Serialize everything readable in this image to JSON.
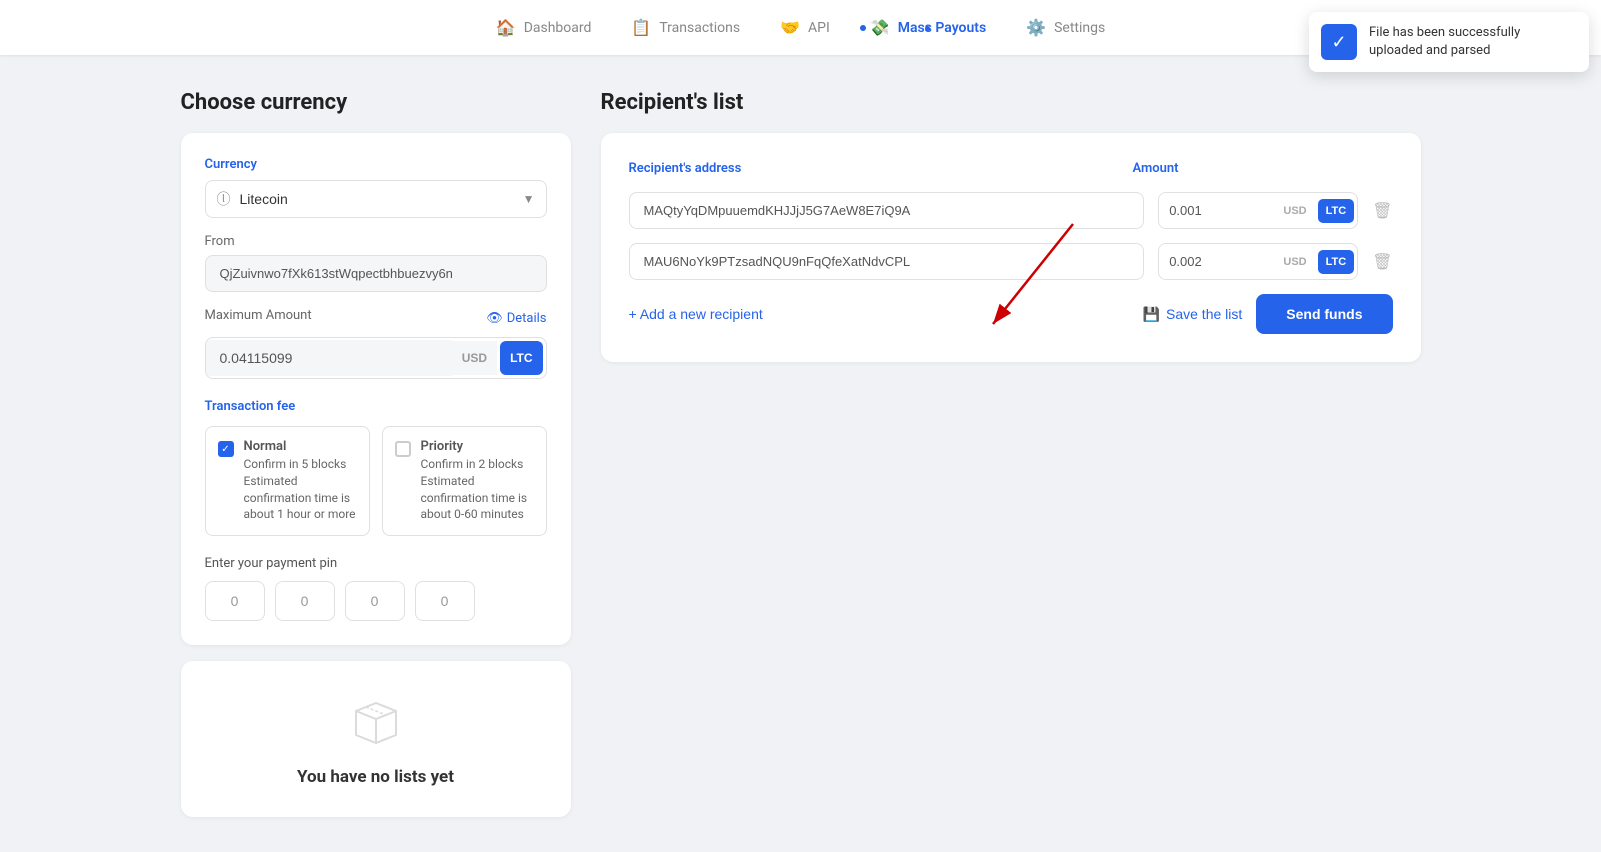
{
  "nav": {
    "items": [
      {
        "id": "dashboard",
        "label": "Dashboard",
        "icon": "🏠",
        "active": false
      },
      {
        "id": "transactions",
        "label": "Transactions",
        "icon": "📋",
        "active": false
      },
      {
        "id": "api",
        "label": "API",
        "icon": "🤝",
        "active": false
      },
      {
        "id": "mass-payouts",
        "label": "Mass Payouts",
        "icon": "💸",
        "active": true
      },
      {
        "id": "settings",
        "label": "Settings",
        "icon": "⚙️",
        "active": false
      }
    ]
  },
  "toast": {
    "message": "File has been successfully uploaded and parsed"
  },
  "left": {
    "section_title": "Choose currency",
    "currency_label": "Currency",
    "currency_value": "Litecoin",
    "from_label": "From",
    "from_value": "QjZuivnwo7fXk613stWqpectbhbuezvy6n",
    "max_amount_label": "Maximum Amount",
    "details_label": "Details",
    "max_amount_value": "0.04115099",
    "usd_btn": "USD",
    "ltc_btn": "LTC",
    "tx_fee_label": "Transaction fee",
    "normal_fee": {
      "name": "Normal",
      "description": "Confirm in 5 blocks Estimated confirmation time is about 1 hour or more"
    },
    "priority_fee": {
      "name": "Priority",
      "description": "Confirm in 2 blocks Estimated confirmation time is about 0-60 minutes"
    },
    "pin_label": "Enter your payment pin",
    "pin_values": [
      "0",
      "0",
      "0",
      "0"
    ]
  },
  "no_lists": {
    "text": "You have no lists yet"
  },
  "right": {
    "section_title": "Recipient's list",
    "addr_col_label": "Recipient's address",
    "amount_col_label": "Amount",
    "recipients": [
      {
        "address": "MAQtyYqDMpuuemdKHJJjJ5G7AeW8E7iQ9A",
        "amount": "0.001",
        "usd": "USD",
        "ltc": "LTC"
      },
      {
        "address": "MAU6NoYk9PTzsadNQU9nFqQfeXatNdvCPL",
        "amount": "0.002",
        "usd": "USD",
        "ltc": "LTC"
      }
    ],
    "add_recipient_label": "+ Add a new recipient",
    "save_list_label": "Save the list",
    "send_funds_label": "Send funds"
  }
}
